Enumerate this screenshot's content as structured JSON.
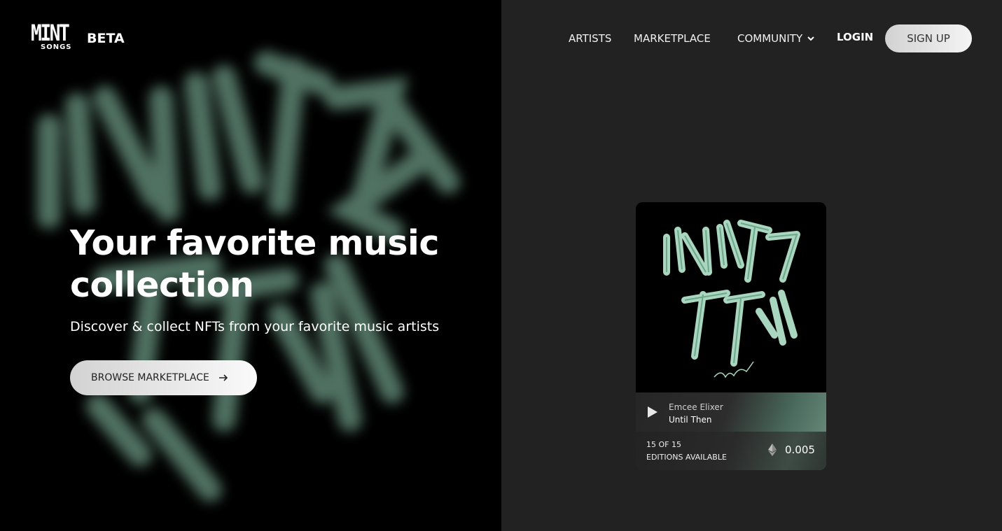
{
  "header": {
    "logo_main": "MINT",
    "logo_sub": "SONGS",
    "logo_badge": "BETA",
    "nav": {
      "artists": "ARTISTS",
      "marketplace": "MARKETPLACE",
      "community": "COMMUNITY",
      "login": "LOGIN",
      "signup": "SIGN UP"
    }
  },
  "hero": {
    "title": "Your favorite music collection",
    "subtitle": "Discover & collect NFTs from your favorite music artists",
    "cta": "BROWSE MARKETPLACE",
    "cta_icon": "arrow-right-icon"
  },
  "featured": {
    "artist": "Emcee Elixer",
    "title": "Until Then",
    "editions_count": "15 OF 15",
    "editions_label": "EDITIONS AVAILABLE",
    "price": "0.005",
    "currency_icon": "ethereum-icon"
  },
  "colors": {
    "accent": "#9cc7b0",
    "background_left": "#000000",
    "background_right": "#222222"
  }
}
